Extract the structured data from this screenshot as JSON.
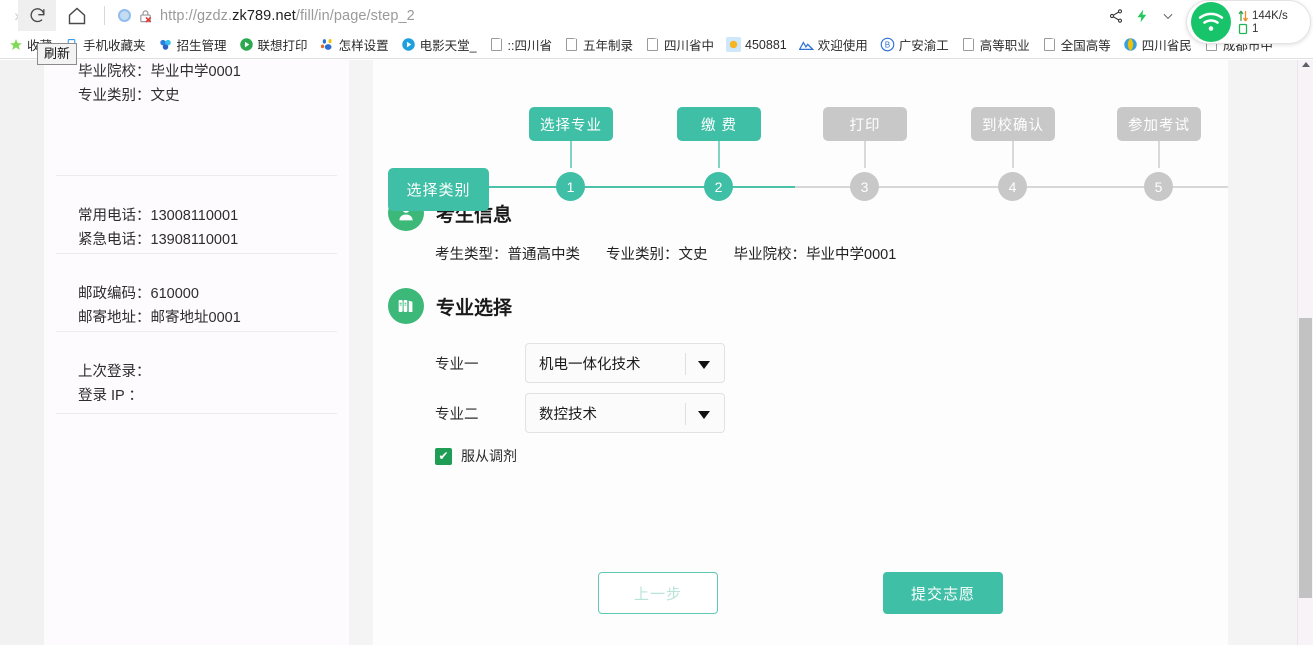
{
  "browser": {
    "back_icon": "back-chevron-icon",
    "reload_label": "reload-icon",
    "home_label": "home-icon",
    "security_icon": "insecure-lock-icon",
    "url_prefix": "http://gzdz.",
    "url_host": "zk789.net",
    "url_path": "/fill/in/page/step_2",
    "url_full": "http://gzdz.zk789.net/fill/in/page/step_2",
    "share_icon": "share-icon",
    "flash_icon": "lightning-icon",
    "chevron_icon": "chevron-down-icon",
    "tooltip": "刷新",
    "network": {
      "wifi_icon": "wifi-icon",
      "speed": "144K/s",
      "battery_count": "1",
      "speed_icon": "up-down-arrows-icon",
      "device_icon": "device-icon"
    },
    "overflow_label": "»"
  },
  "bookmarks": [
    {
      "label": "收藏",
      "icon": "star-favorites-icon"
    },
    {
      "label": "手机收藏夹",
      "icon": "mobile-bookmarks-icon"
    },
    {
      "label": "招生管理",
      "icon": "flower-icon"
    },
    {
      "label": "联想打印",
      "icon": "play-circle-icon"
    },
    {
      "label": "怎样设置",
      "icon": "baidu-paw-icon"
    },
    {
      "label": "电影天堂_",
      "icon": "blue-circle-icon"
    },
    {
      "label": "::四川省",
      "icon": "page-icon"
    },
    {
      "label": "五年制录",
      "icon": "page-icon"
    },
    {
      "label": "四川省中",
      "icon": "page-icon"
    },
    {
      "label": "450881",
      "icon": "sun-icon"
    },
    {
      "label": "欢迎使用",
      "icon": "mountain-icon"
    },
    {
      "label": "广安渝工",
      "icon": "b-circle-icon"
    },
    {
      "label": "高等职业",
      "icon": "page-icon"
    },
    {
      "label": "全国高等",
      "icon": "page-icon"
    },
    {
      "label": "四川省民",
      "icon": "globe-icon"
    },
    {
      "label": "成都市中",
      "icon": "page-icon"
    }
  ],
  "info_panel": {
    "groups": [
      {
        "lines": [
          "毕业院校：毕业中学0001",
          "专业类别：文史"
        ]
      },
      {
        "lines": [
          "常用电话：13008110001",
          "紧急电话：13908110001"
        ]
      },
      {
        "lines": [
          "邮政编码：610000",
          "邮寄地址：邮寄地址0001"
        ]
      },
      {
        "lines": [
          "上次登录：",
          " 登录 IP ："
        ]
      }
    ]
  },
  "stepper": {
    "category_chip": "选择类别",
    "steps": [
      {
        "num": "1",
        "label": "选择专业",
        "state": "active"
      },
      {
        "num": "2",
        "label": "缴 费",
        "state": "active"
      },
      {
        "num": "3",
        "label": "打印",
        "state": "idle"
      },
      {
        "num": "4",
        "label": "到校确认",
        "state": "idle"
      },
      {
        "num": "5",
        "label": "参加考试",
        "state": "idle"
      }
    ]
  },
  "candidate_section": {
    "icon": "person-icon",
    "title": "考生信息",
    "fields": [
      "考生类型：普通高中类",
      "专业类别：文史",
      "毕业院校：毕业中学0001"
    ]
  },
  "major_section": {
    "icon": "books-icon",
    "title": "专业选择",
    "rows": [
      {
        "label": "专业一",
        "value": "机电一体化技术"
      },
      {
        "label": "专业二",
        "value": "数控技术"
      }
    ],
    "consent": {
      "label": "服从调剂",
      "checked": true,
      "check_glyph": "✔"
    }
  },
  "footer": {
    "prev_label": "上一步",
    "submit_label": "提交志愿"
  },
  "colors": {
    "teal": "#3fbfa6",
    "green": "#3cb878",
    "idle_gray": "#c8c8c8"
  }
}
